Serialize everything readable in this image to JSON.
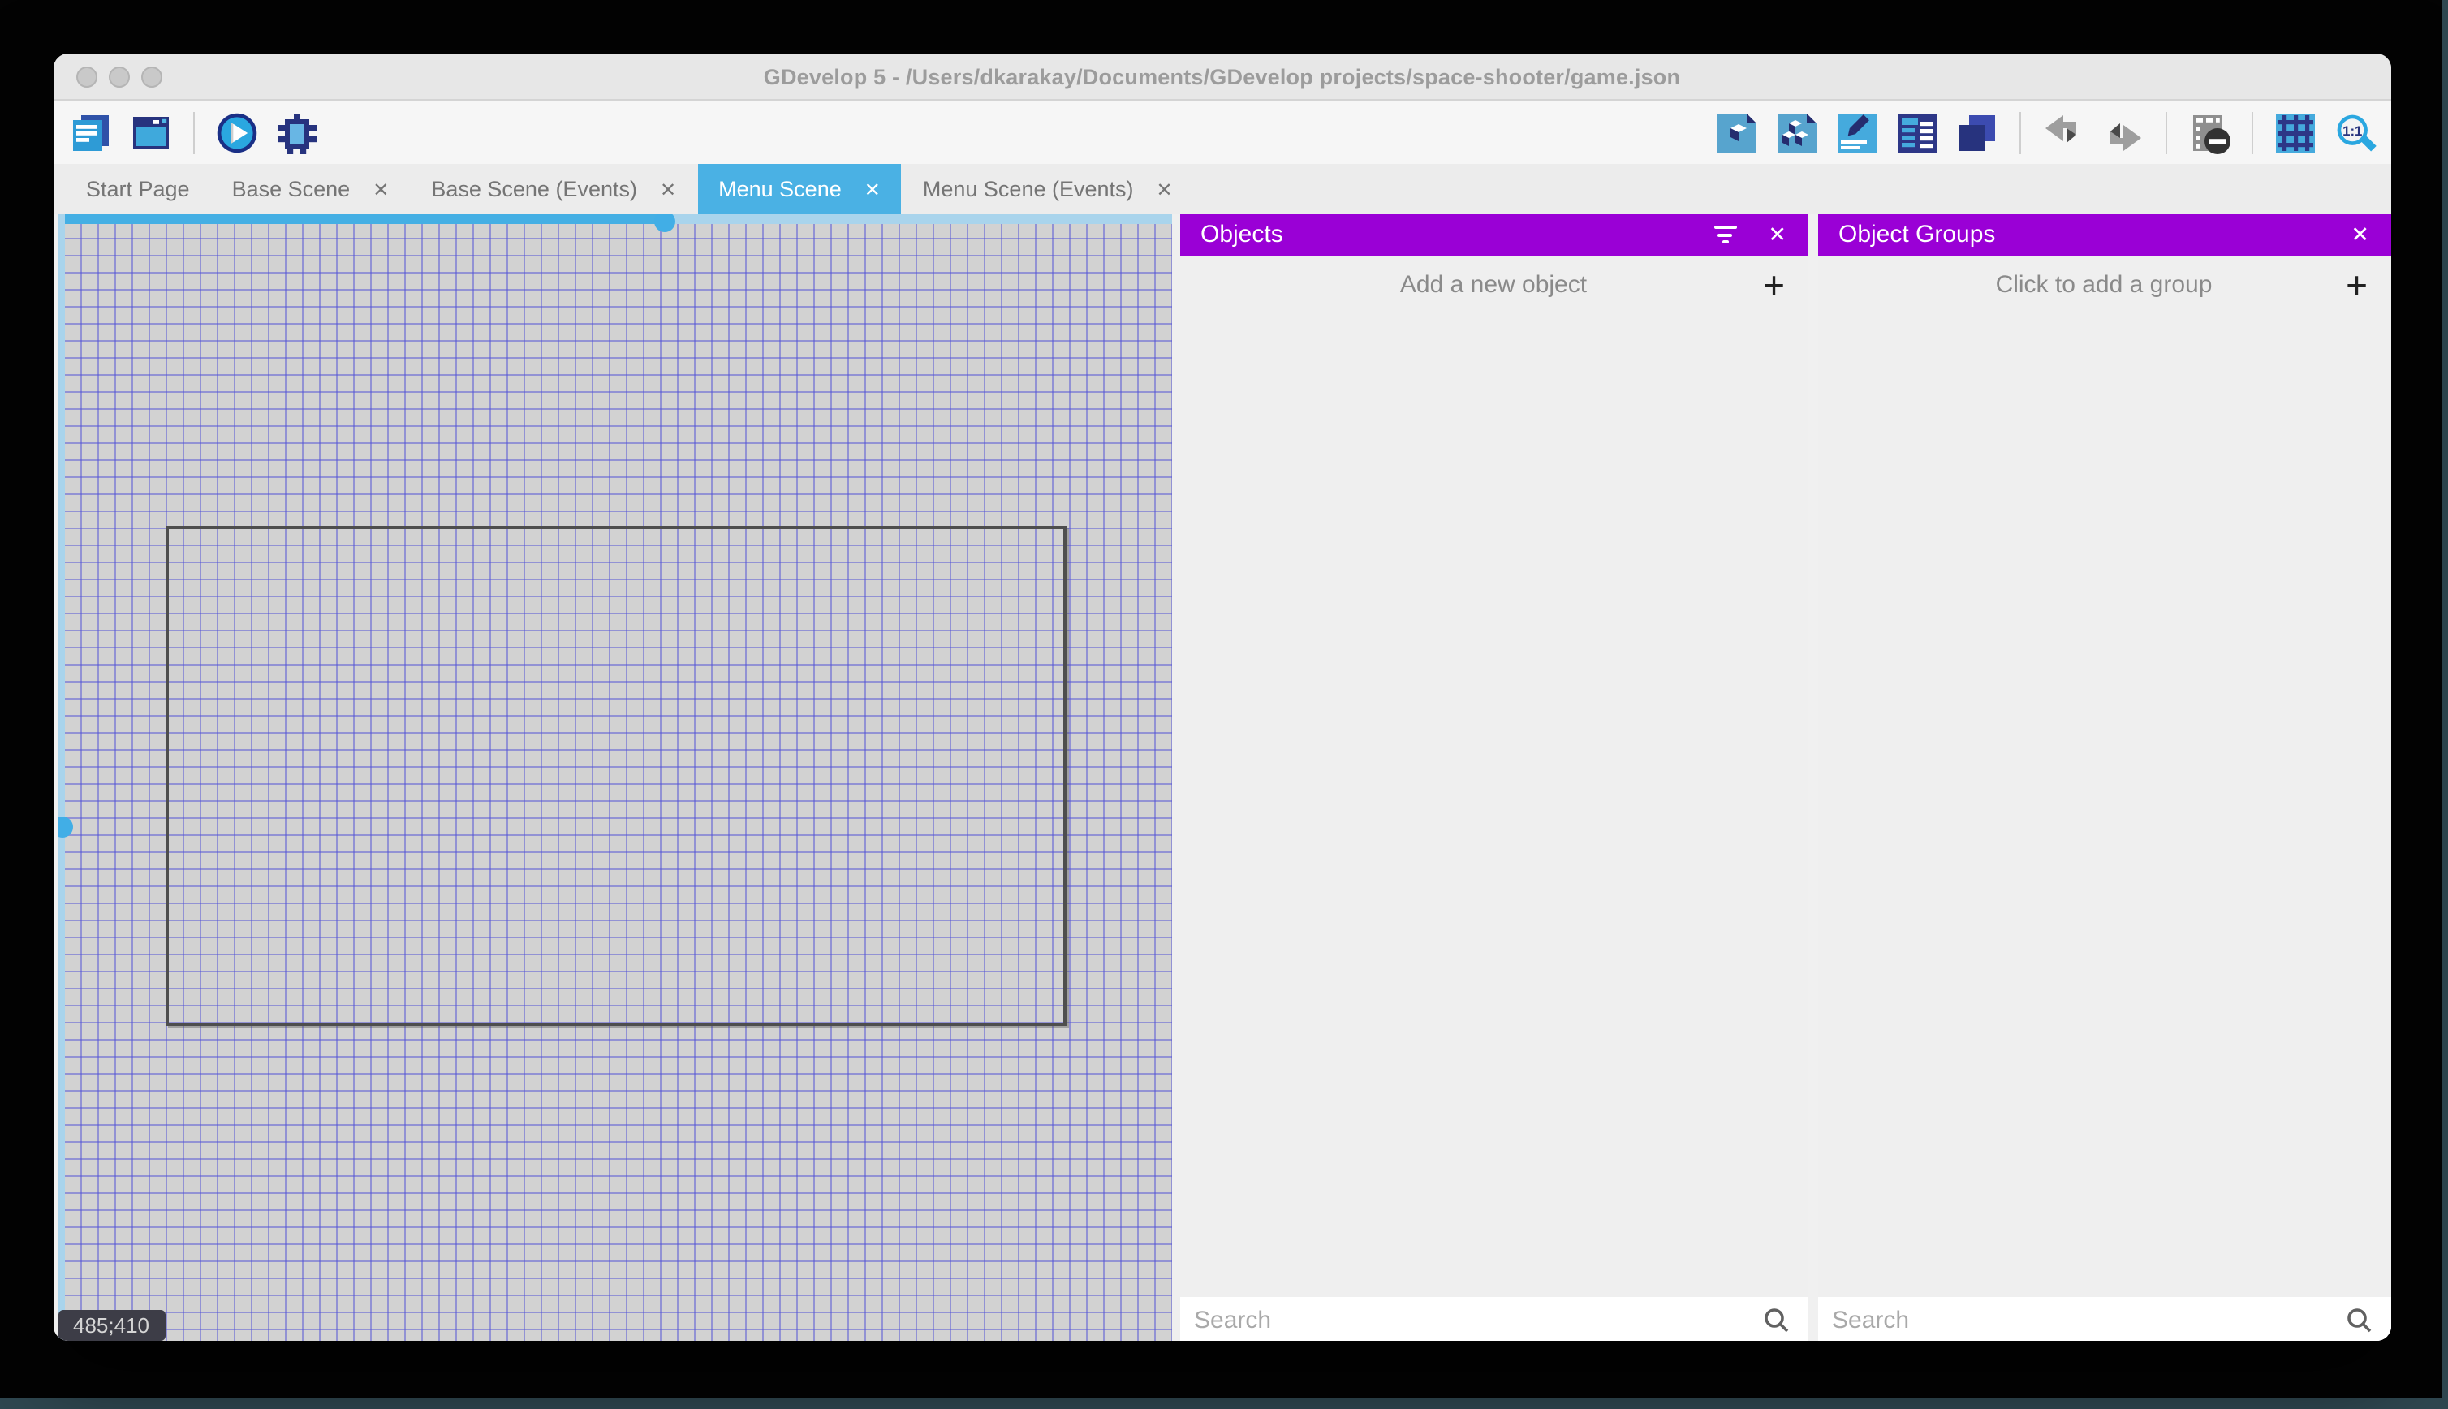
{
  "window": {
    "title": "GDevelop 5 - /Users/dkarakay/Documents/GDevelop projects/space-shooter/game.json",
    "traffic_lights": [
      "close",
      "minimize",
      "zoom"
    ],
    "focused": false
  },
  "toolbar": {
    "left_icons": [
      "project-manager-icon",
      "scene-window-icon",
      "play-icon",
      "debugger-icon"
    ],
    "right_icons": [
      "objects-editor-icon",
      "object-groups-editor-icon",
      "properties-icon",
      "instances-list-icon",
      "layers-editor-icon",
      "undo-icon",
      "redo-icon",
      "window-mask-icon",
      "grid-toggle-icon",
      "zoom-options-icon"
    ]
  },
  "tabs": [
    {
      "label": "Start Page",
      "closable": false,
      "active": false
    },
    {
      "label": "Base Scene",
      "closable": true,
      "active": false
    },
    {
      "label": "Base Scene (Events)",
      "closable": true,
      "active": false
    },
    {
      "label": "Menu Scene",
      "closable": true,
      "active": true
    },
    {
      "label": "Menu Scene (Events)",
      "closable": true,
      "active": false
    }
  ],
  "canvas": {
    "coordinates_badge": "485;410",
    "selection_handles": 2,
    "grid_visible": true
  },
  "objects_panel": {
    "title": "Objects",
    "add_label": "Add a new object",
    "search_placeholder": "Search",
    "header_icons": [
      "filter-icon",
      "close-icon"
    ]
  },
  "object_groups_panel": {
    "title": "Object Groups",
    "add_label": "Click to add a group",
    "search_placeholder": "Search",
    "header_icons": [
      "close-icon"
    ]
  },
  "icons": {
    "tab_close": "✕",
    "panel_close": "✕",
    "add_plus": "+"
  },
  "colors": {
    "accent_blue": "#4ab1e4",
    "panel_header_purple": "#9a00d6",
    "grid_line": "#5252d6",
    "grid_background": "#d2d2d2",
    "selection_light_blue": "#a9d4ec",
    "titlebar_gray": "#e7e7e7",
    "badge_background": "#3d3d47"
  }
}
